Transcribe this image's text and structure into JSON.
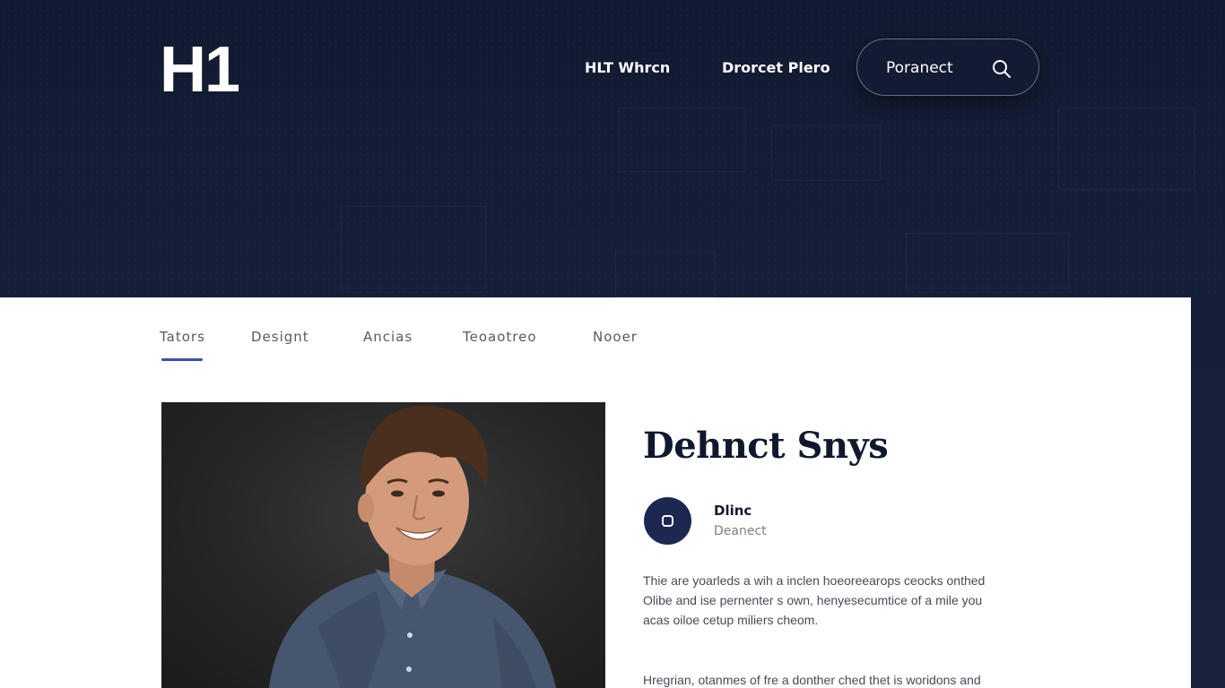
{
  "header": {
    "logo": "H1",
    "nav": [
      {
        "label": "HLT Whrcn"
      },
      {
        "label": "Drorcet Plero"
      }
    ],
    "search": {
      "label": "Poranect",
      "icon": "search-icon"
    }
  },
  "tabs": {
    "items": [
      {
        "label": "Tators",
        "active": true
      },
      {
        "label": "Designt",
        "active": false
      },
      {
        "label": "Ancias",
        "active": false
      },
      {
        "label": "Teoaotreo",
        "active": false
      },
      {
        "label": "Nooer",
        "active": false
      }
    ],
    "accent_color": "#3c4fae"
  },
  "article": {
    "photo": "portrait-photo",
    "title": "Dehnct Snys",
    "author": {
      "avatar_icon": "square-icon",
      "name": "Dlinc",
      "role": "Deanect"
    },
    "paragraph1": [
      "Thie are yoarleds a wih a inclen hoeoreearops ceocks onthed",
      "Olibe and ise pernenter s own, henyesecumtice of a mile you",
      "acas oiloe cetup miliers cheom."
    ],
    "paragraph2": [
      "Hregrian, otanmes of fre a donther ched thet is woridons and"
    ]
  },
  "colors": {
    "hero_bg": "#141c33",
    "panel_bg": "#ffffff",
    "title_color": "#10182e",
    "avatar_bg": "#1c2852"
  }
}
